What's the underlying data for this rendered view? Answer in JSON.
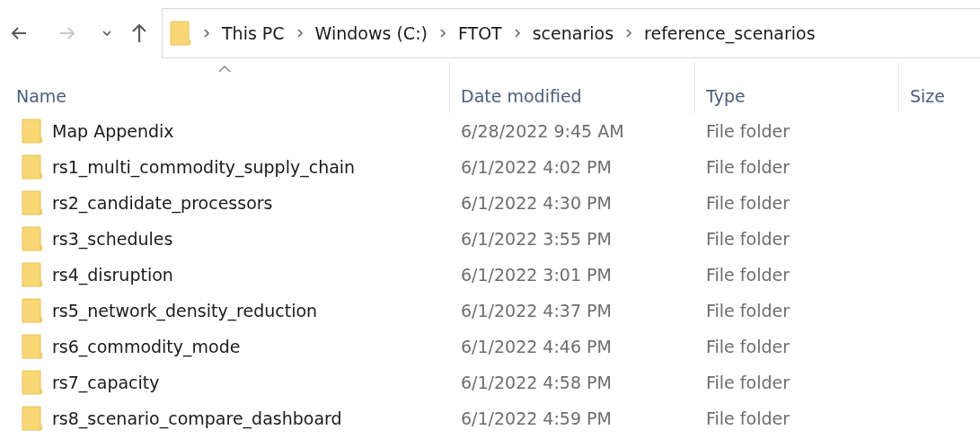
{
  "nav": {
    "back": {
      "disabled": false
    },
    "forward": {
      "disabled": true
    },
    "up": {
      "disabled": false
    }
  },
  "breadcrumbs": [
    "This PC",
    "Windows (C:)",
    "FTOT",
    "scenarios",
    "reference_scenarios"
  ],
  "columns": [
    {
      "label": "Name",
      "sorted": true
    },
    {
      "label": "Date modified",
      "sorted": false
    },
    {
      "label": "Type",
      "sorted": false
    },
    {
      "label": "Size",
      "sorted": false
    }
  ],
  "rows": [
    {
      "name": "Map Appendix",
      "date": "6/28/2022 9:45 AM",
      "type": "File folder"
    },
    {
      "name": "rs1_multi_commodity_supply_chain",
      "date": "6/1/2022 4:02 PM",
      "type": "File folder"
    },
    {
      "name": "rs2_candidate_processors",
      "date": "6/1/2022 4:30 PM",
      "type": "File folder"
    },
    {
      "name": "rs3_schedules",
      "date": "6/1/2022 3:55 PM",
      "type": "File folder"
    },
    {
      "name": "rs4_disruption",
      "date": "6/1/2022 3:01 PM",
      "type": "File folder"
    },
    {
      "name": "rs5_network_density_reduction",
      "date": "6/1/2022 4:37 PM",
      "type": "File folder"
    },
    {
      "name": "rs6_commodity_mode",
      "date": "6/1/2022 4:46 PM",
      "type": "File folder"
    },
    {
      "name": "rs7_capacity",
      "date": "6/1/2022 4:58 PM",
      "type": "File folder"
    },
    {
      "name": "rs8_scenario_compare_dashboard",
      "date": "6/1/2022 4:59 PM",
      "type": "File folder"
    }
  ]
}
